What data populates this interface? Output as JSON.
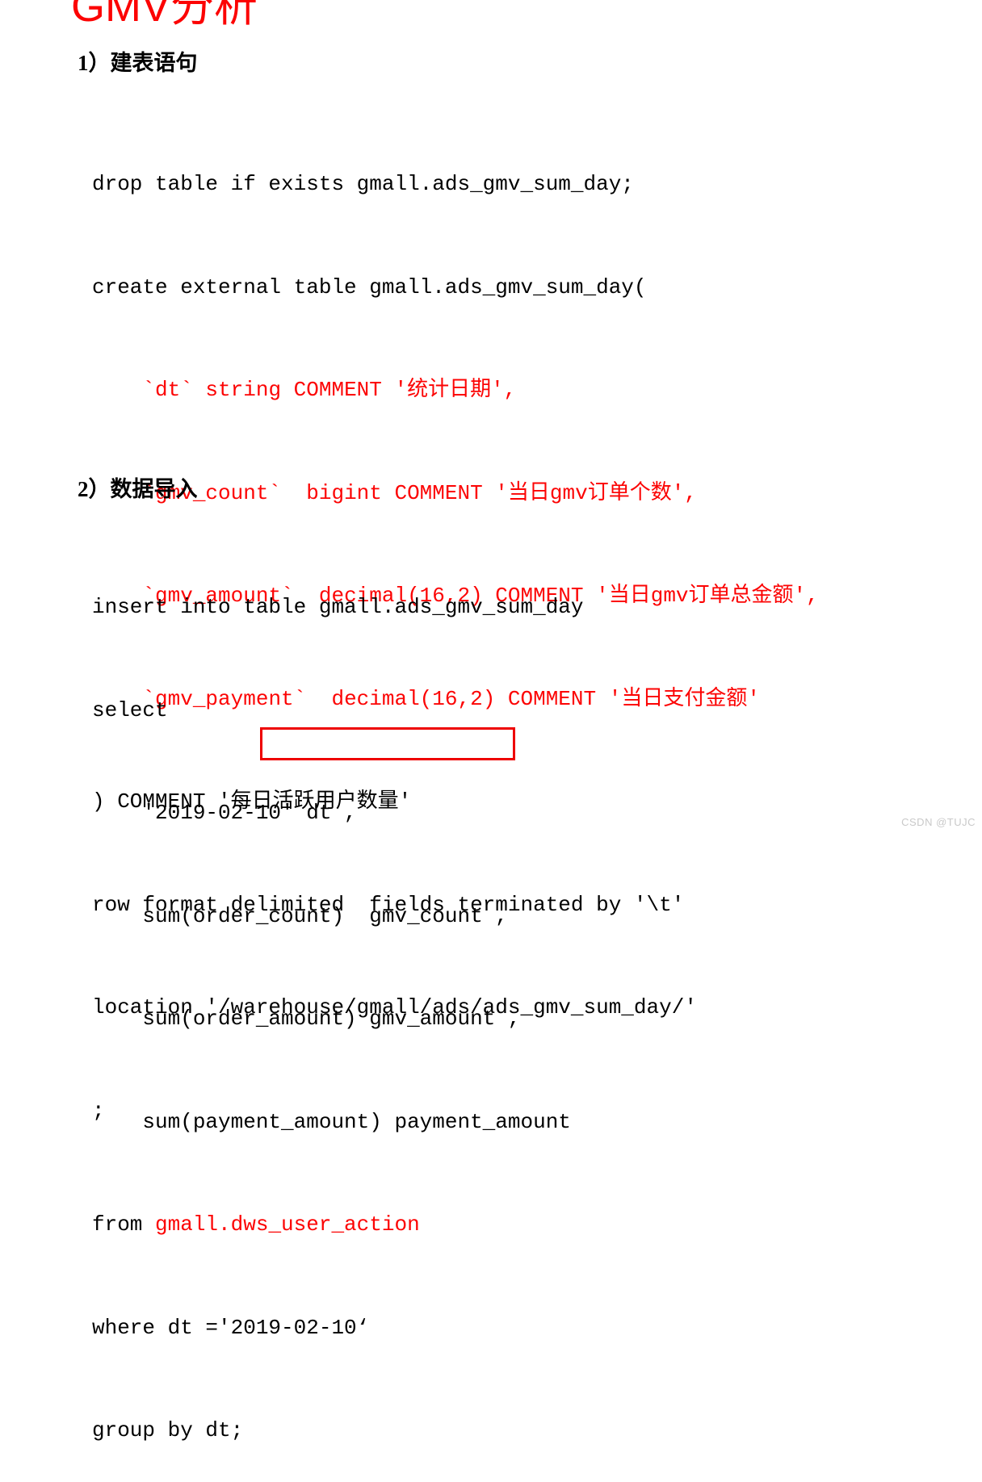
{
  "title": "GMV分析",
  "accent_color": "#fc0303",
  "text_color": "#000000",
  "background_color": "#ffffff",
  "sections": [
    {
      "heading": "1）建表语句"
    },
    {
      "heading": "2）数据导入"
    }
  ],
  "code_create": {
    "lines": [
      {
        "black": "drop table if exists gmall.ads_gmv_sum_day;",
        "red": ""
      },
      {
        "black": "create external table gmall.ads_gmv_sum_day(",
        "red": ""
      },
      {
        "black": "    ",
        "red": "`dt` string COMMENT '统计日期',"
      },
      {
        "black": "    ",
        "red": "`gmv_count`  bigint COMMENT '当日gmv订单个数',"
      },
      {
        "black": "    ",
        "red": "`gmv_amount`  decimal(16,2) COMMENT '当日gmv订单总金额',"
      },
      {
        "black": "    ",
        "red": "`gmv_payment`  decimal(16,2) COMMENT '当日支付金额'"
      },
      {
        "black": ") COMMENT '每日活跃用户数量'",
        "red": ""
      },
      {
        "black": "row format delimited  fields terminated by '\\t'",
        "red": ""
      },
      {
        "black": "location '/warehouse/gmall/ads/ads_gmv_sum_day/'",
        "red": ""
      },
      {
        "black": ";",
        "red": ""
      }
    ]
  },
  "code_insert": {
    "lines": [
      {
        "black": "insert into table gmall.ads_gmv_sum_day",
        "red": ""
      },
      {
        "black": "select",
        "red": ""
      },
      {
        "black": "    '2019-02-10' dt ,",
        "red": ""
      },
      {
        "black": "    sum(order_count)  gmv_count ,",
        "red": ""
      },
      {
        "black": "    sum(order_amount) gmv_amount ,",
        "red": ""
      },
      {
        "black": "    sum(payment_amount) payment_amount",
        "red": ""
      },
      {
        "black": "from ",
        "red": "gmall.dws_user_action"
      },
      {
        "black": "where dt ='2019-02-10‘",
        "red": ""
      },
      {
        "black": "group by dt;",
        "red": ""
      }
    ]
  },
  "highlight": {
    "target_text": "dws_user_action",
    "border_color": "#ee0000"
  },
  "watermark": "CSDN @TUJC"
}
